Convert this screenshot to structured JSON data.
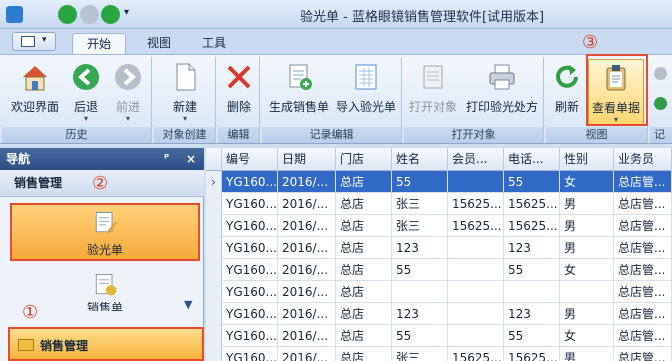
{
  "window": {
    "title": "验光单 - 蓝格眼镜销售管理软件[试用版本]"
  },
  "tabs": [
    {
      "label": "开始"
    },
    {
      "label": "视图"
    },
    {
      "label": "工具"
    }
  ],
  "ribbon": {
    "groups": [
      {
        "label": "历史",
        "buttons": [
          {
            "label": "欢迎界面"
          },
          {
            "label": "后退"
          },
          {
            "label": "前进"
          }
        ]
      },
      {
        "label": "对象创建",
        "buttons": [
          {
            "label": "新建"
          }
        ]
      },
      {
        "label": "编辑",
        "buttons": [
          {
            "label": "删除"
          }
        ]
      },
      {
        "label": "记录编辑",
        "buttons": [
          {
            "label": "生成销售单"
          },
          {
            "label": "导入验光单"
          }
        ]
      },
      {
        "label": "打开对象",
        "buttons": [
          {
            "label": "打开对象"
          },
          {
            "label": "打印验光处方"
          }
        ]
      },
      {
        "label": "视图",
        "buttons": [
          {
            "label": "刷新"
          },
          {
            "label": "查看单据"
          }
        ]
      },
      {
        "label": "记"
      }
    ]
  },
  "annotations": {
    "one": "①",
    "two": "②",
    "three": "③"
  },
  "nav": {
    "header": "导航",
    "pin": "ᴾ",
    "close": "×",
    "section": "销售管理",
    "items": [
      {
        "label": "验光单"
      },
      {
        "label": "销售单"
      }
    ],
    "bottom": "销售管理"
  },
  "grid": {
    "columns": [
      "编号",
      "日期",
      "门店",
      "姓名",
      "会员...",
      "电话...",
      "性别",
      "业务员"
    ],
    "rows": [
      [
        "YG160...",
        "2016/...",
        "总店",
        "55",
        "",
        "55",
        "女",
        "总店管..."
      ],
      [
        "YG160...",
        "2016/...",
        "总店",
        "张三",
        "15625...",
        "15625...",
        "男",
        "总店管..."
      ],
      [
        "YG160...",
        "2016/...",
        "总店",
        "张三",
        "15625...",
        "15625...",
        "男",
        "总店管..."
      ],
      [
        "YG160...",
        "2016/...",
        "总店",
        "123",
        "",
        "123",
        "男",
        "总店管..."
      ],
      [
        "YG160...",
        "2016/...",
        "总店",
        "55",
        "",
        "55",
        "女",
        "总店管..."
      ],
      [
        "YG160...",
        "2016/...",
        "总店",
        "",
        "",
        "",
        "",
        "总店管..."
      ],
      [
        "YG160...",
        "2016/...",
        "总店",
        "123",
        "",
        "123",
        "男",
        "总店管..."
      ],
      [
        "YG160...",
        "2016/...",
        "总店",
        "55",
        "",
        "55",
        "女",
        "总店管..."
      ],
      [
        "YG160...",
        "2016/...",
        "总店",
        "张三",
        "15625...",
        "15625...",
        "男",
        "总店管..."
      ]
    ]
  },
  "colors": {
    "accent": "#3169c6",
    "highlight": "#e64b32",
    "selected_nav": "#f5b23a"
  }
}
